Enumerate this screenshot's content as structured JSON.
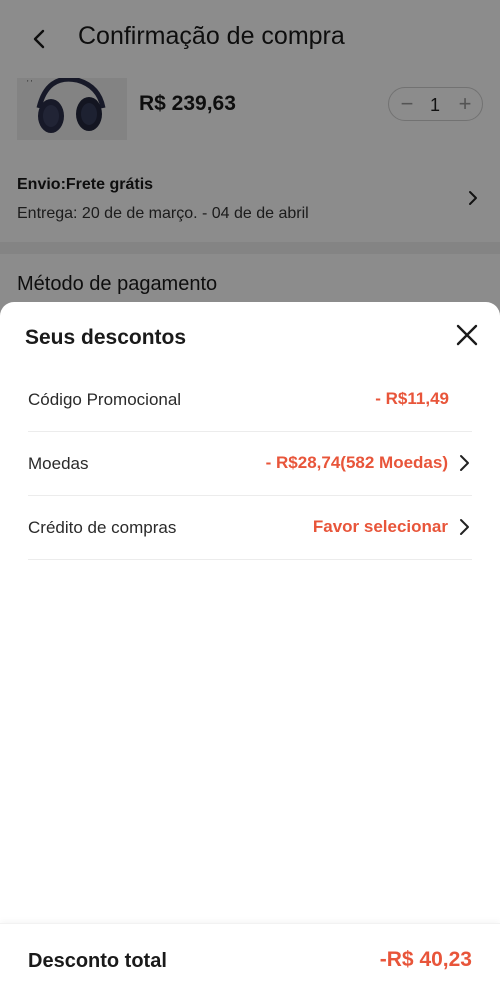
{
  "header": {
    "title": "Confirmação de compra",
    "back_icon": "chevron-left-icon"
  },
  "product": {
    "price": "R$ 239,63",
    "quantity": "1",
    "thumbnail": "headphones-image"
  },
  "shipping": {
    "method": "Envio:Frete grátis",
    "delivery": "Entrega: 20 de de março. - 04 de de abril"
  },
  "payment": {
    "section_title": "Método de pagamento"
  },
  "discounts_sheet": {
    "title": "Seus descontos",
    "close_icon": "close-icon",
    "rows": [
      {
        "label": "Código Promocional",
        "value": "- R$11,49",
        "has_chevron": false
      },
      {
        "label": "Moedas",
        "value": "- R$28,74(582 Moedas)",
        "has_chevron": true
      },
      {
        "label": "Crédito de compras",
        "value": "Favor selecionar",
        "has_chevron": true
      }
    ],
    "total_label": "Desconto total",
    "total_value": "-R$ 40,23"
  },
  "colors": {
    "accent": "#e8553a",
    "overlay": "rgba(0,0,0,0.45)",
    "text": "#1a1a1a"
  }
}
